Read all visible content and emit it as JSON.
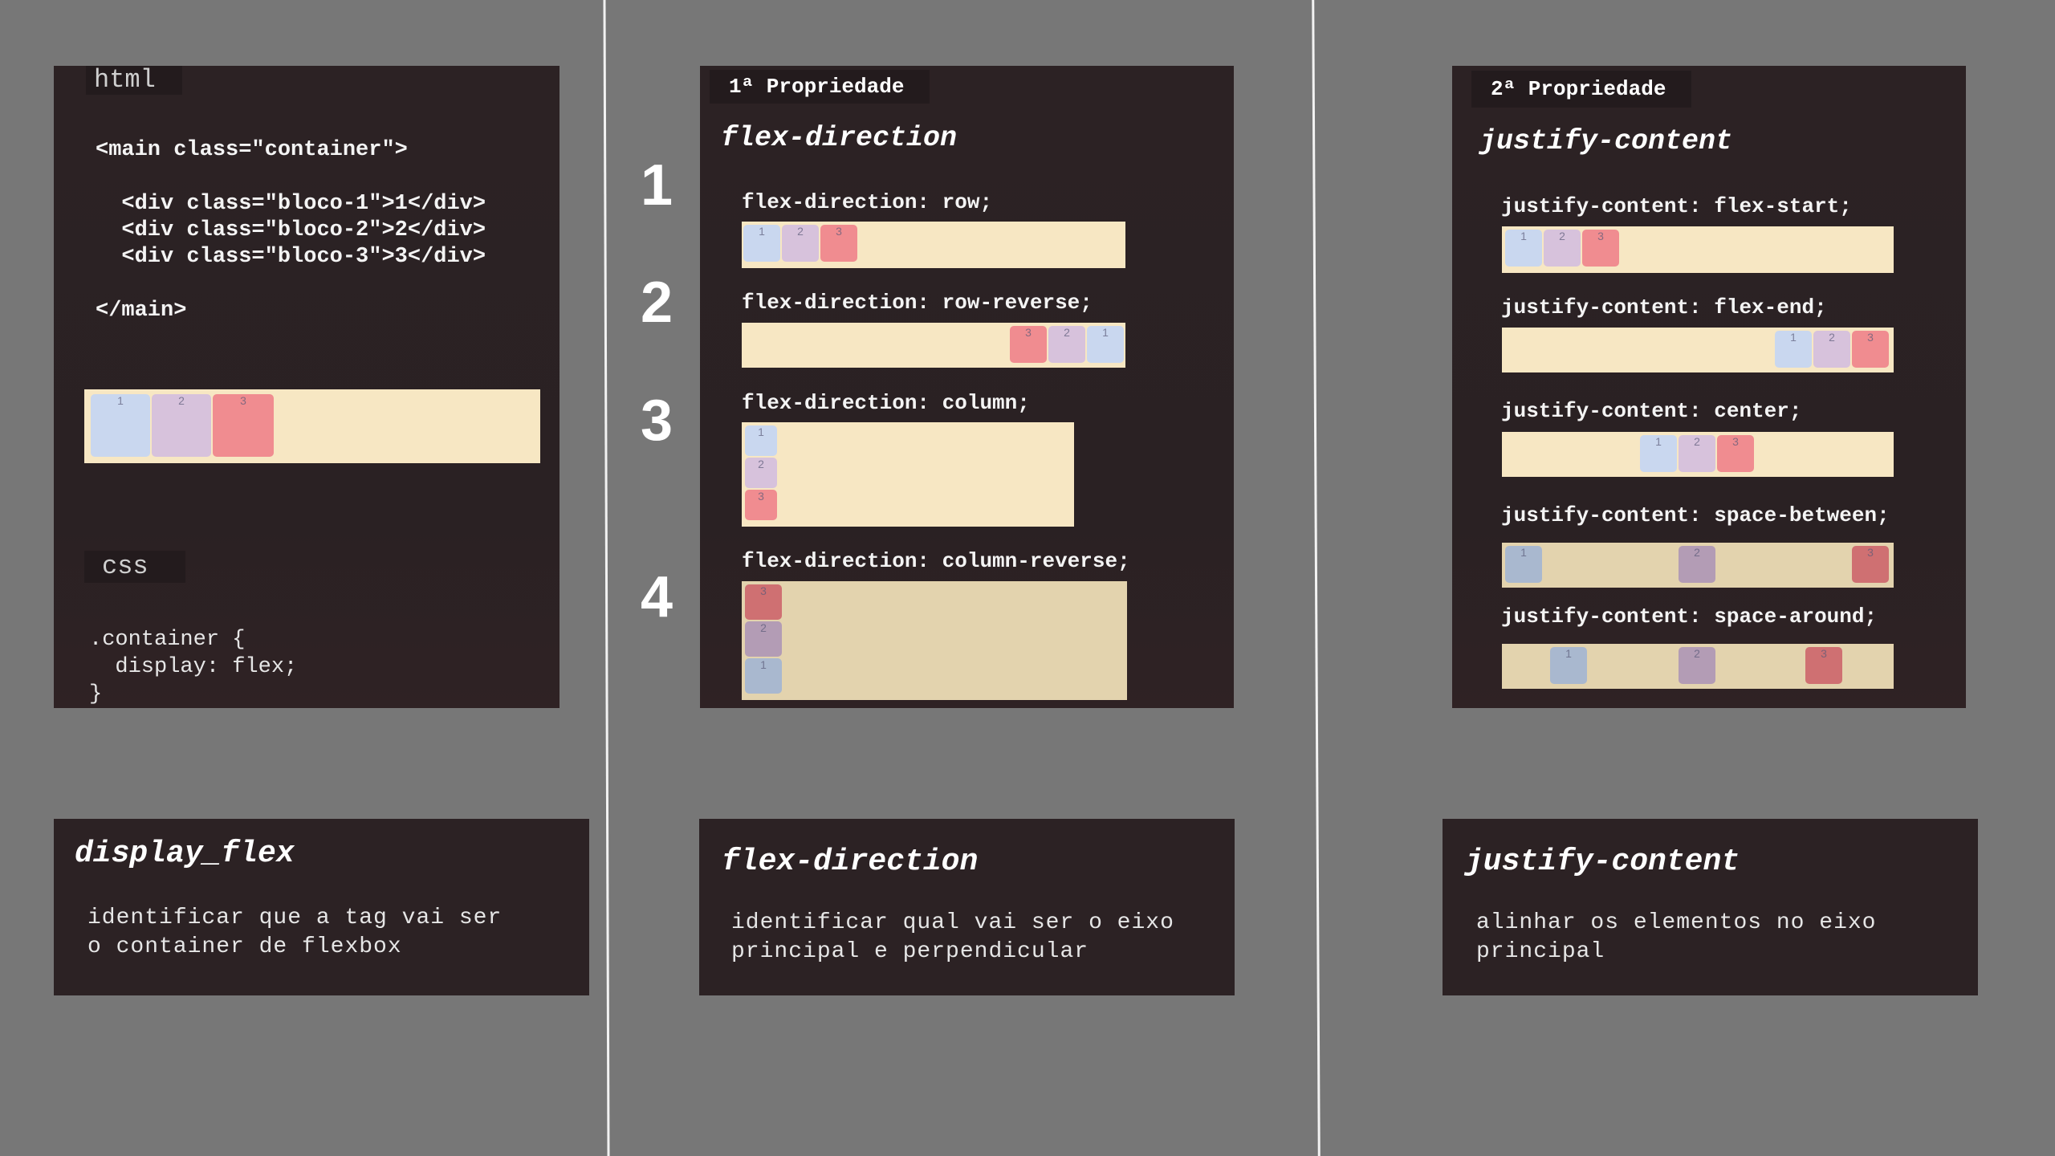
{
  "panel1": {
    "html_tag": "html",
    "code_lines": [
      "<main class=\"container\">",
      "  <div class=\"bloco-1\">1</div>",
      "  <div class=\"bloco-2\">2</div>",
      "  <div class=\"bloco-3\">3</div>",
      "</main>"
    ],
    "demo_boxes": [
      "1",
      "2",
      "3"
    ],
    "css_tag": "css",
    "css_lines": [
      ".container {",
      "  display: flex;",
      "}"
    ]
  },
  "panel2": {
    "badge": "1ª Propriedade",
    "title": "flex-direction",
    "numbers": [
      "1",
      "2",
      "3",
      "4"
    ],
    "rules": [
      {
        "label": "flex-direction: row;",
        "boxes": [
          "1",
          "2",
          "3"
        ]
      },
      {
        "label": "flex-direction: row-reverse;",
        "boxes": [
          "3",
          "2",
          "1"
        ]
      },
      {
        "label": "flex-direction: column;",
        "boxes": [
          "1",
          "2",
          "3"
        ]
      },
      {
        "label": "flex-direction: column-reverse;",
        "boxes": [
          "3",
          "2",
          "1"
        ]
      }
    ]
  },
  "panel3": {
    "badge": "2ª Propriedade",
    "title": "justify-content",
    "rules": [
      {
        "label": "justify-content: flex-start;",
        "boxes": [
          "1",
          "2",
          "3"
        ]
      },
      {
        "label": "justify-content: flex-end;",
        "boxes": [
          "1",
          "2",
          "3"
        ]
      },
      {
        "label": "justify-content: center;",
        "boxes": [
          "1",
          "2",
          "3"
        ]
      },
      {
        "label": "justify-content: space-between;",
        "boxes": [
          "1",
          "2",
          "3"
        ]
      },
      {
        "label": "justify-content: space-around;",
        "boxes": [
          "1",
          "2",
          "3"
        ]
      }
    ]
  },
  "captions": [
    {
      "title": "display_flex",
      "lines": [
        "identificar que a tag vai ser",
        "o container de flexbox"
      ]
    },
    {
      "title": "flex-direction",
      "lines": [
        "identificar qual vai ser o eixo",
        "principal e perpendicular"
      ]
    },
    {
      "title": "justify-content",
      "lines": [
        "alinhar os elementos no eixo",
        "principal"
      ]
    }
  ],
  "colors": {
    "background": "#777777",
    "panel": "#2c2224",
    "container_fill": "#f7e7c3",
    "bloco_1": "#c9d7ef",
    "bloco_2": "#d7c2dc",
    "bloco_3": "#f08c90"
  }
}
